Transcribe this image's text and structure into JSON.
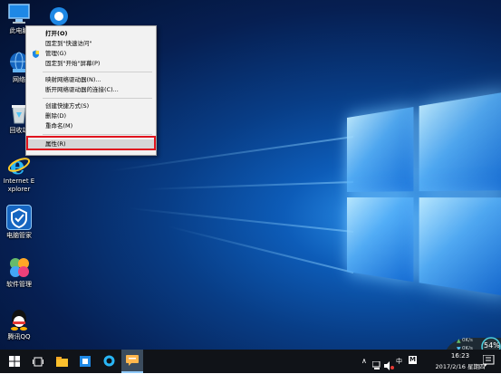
{
  "desktop_icons": [
    {
      "id": "computer",
      "label": "此电脑",
      "icon": "computer-icon"
    },
    {
      "id": "network",
      "label": "网络",
      "icon": "network-icon"
    },
    {
      "id": "recycle",
      "label": "回收站",
      "icon": "recycle-bin-icon"
    },
    {
      "id": "ie",
      "label": "Internet Explorer",
      "icon": "internet-explorer-icon"
    },
    {
      "id": "pcmgr",
      "label": "电脑管家",
      "icon": "pc-manager-icon"
    },
    {
      "id": "softmgr",
      "label": "软件管理",
      "icon": "software-manager-icon"
    },
    {
      "id": "qq",
      "label": "腾讯QQ",
      "icon": "qq-icon"
    }
  ],
  "context_menu": {
    "items": [
      {
        "label": "打开(O)",
        "bold": true
      },
      {
        "label": "固定到\"快速访问\""
      },
      {
        "label": "管理(G)",
        "icon": "shield-icon"
      },
      {
        "label": "固定到\"开始\"屏幕(P)"
      },
      {
        "label": "映射网络驱动器(N)..."
      },
      {
        "label": "断开网络驱动器的连接(C)..."
      },
      {
        "label": "创建快捷方式(S)"
      },
      {
        "label": "删除(D)"
      },
      {
        "label": "重命名(M)"
      },
      {
        "label": "属性(R)",
        "highlighted": true
      }
    ]
  },
  "taskbar": {
    "buttons": [
      "windows-start-icon",
      "task-view-icon",
      "file-explorer-icon",
      "store-icon",
      "browser-icon",
      "chat-app-icon"
    ],
    "tray": {
      "ime_label": "中",
      "ime_mode": "M",
      "time": "16:23",
      "date": "2017/2/16 星期四"
    }
  },
  "network_widget": {
    "upload": "0K/s",
    "download": "0K/s",
    "percent": "54%"
  },
  "colors": {
    "highlight_border": "#e0141e",
    "taskbar": "#101318"
  }
}
